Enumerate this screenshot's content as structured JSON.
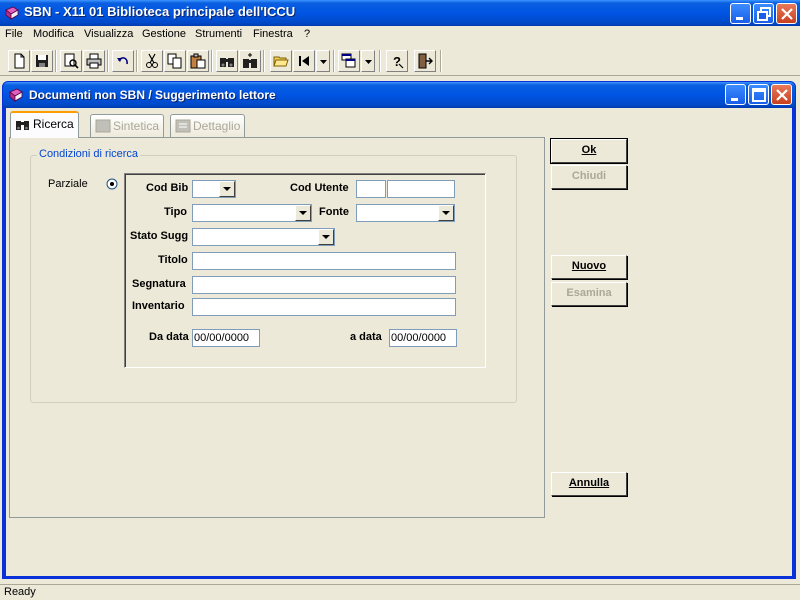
{
  "app": {
    "title": "SBN - X11 01 Biblioteca principale dell'ICCU"
  },
  "menu": [
    "File",
    "Modifica",
    "Visualizza",
    "Gestione",
    "Strumenti",
    "Finestra",
    "?"
  ],
  "toolbar": {
    "icons": [
      "new-document-icon",
      "save-icon",
      "print-preview-icon",
      "print-icon",
      "undo-icon",
      "cut-icon",
      "copy-icon",
      "paste-icon",
      "find-icon",
      "find-next-icon",
      "open-folder-icon",
      "first-record-icon",
      "dropdown-icon",
      "window-list-icon",
      "dropdown-icon",
      "help-icon",
      "exit-icon"
    ]
  },
  "child_window": {
    "title": "Documenti non SBN / Suggerimento lettore"
  },
  "tabs": [
    {
      "label": "Ricerca",
      "state": "active"
    },
    {
      "label": "Sintetica",
      "state": "disabled"
    },
    {
      "label": "Dettaglio",
      "state": "disabled"
    }
  ],
  "form": {
    "group_label": "Condizioni di ricerca",
    "radio_label": "Parziale",
    "cod_bib_label": "Cod Bib",
    "cod_bib_value": "",
    "cod_utente_label": "Cod Utente",
    "cod_utente_value1": "",
    "cod_utente_value2": "",
    "tipo_label": "Tipo",
    "tipo_value": "",
    "fonte_label": "Fonte",
    "fonte_value": "",
    "stato_sugg_label": "Stato Sugg",
    "stato_sugg_value": "",
    "titolo_label": "Titolo",
    "titolo_value": "",
    "segnatura_label": "Segnatura",
    "segnatura_value": "",
    "inventario_label": "Inventario",
    "inventario_value": "",
    "da_data_label": "Da data",
    "da_data_value": "00/00/0000",
    "a_data_label": "a data",
    "a_data_value": "00/00/0000"
  },
  "buttons": {
    "ok": "Ok",
    "chiudi": "Chiudi",
    "nuovo": "Nuovo",
    "esamina": "Esamina",
    "annulla": "Annulla"
  },
  "status": {
    "text": "Ready"
  },
  "colors": {
    "titlebar": "#0054e3",
    "group_label": "#0046d5",
    "face": "#ece9d8"
  }
}
